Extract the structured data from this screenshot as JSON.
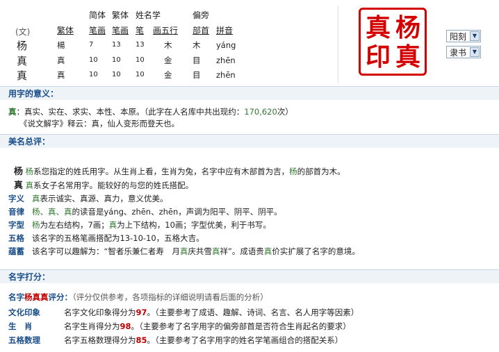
{
  "top_table": {
    "header_row1": {
      "jianti": "简体",
      "fanti": "繁体",
      "xingming": "姓名学",
      "pianpang": "偏旁"
    },
    "header_row2": {
      "wen": "(文)",
      "fanti": "繁体",
      "jianti_bihua": "笔画",
      "fanti_bihua": "笔画",
      "bi": "笔",
      "hua_wuxing": "画五行",
      "bushou": "部首",
      "pinyin": "拼音"
    },
    "rows": [
      {
        "char": "杨",
        "fanti": "楊",
        "jb": "7",
        "fb": "13",
        "xb": "13",
        "wuxing": "木",
        "bushou": "木",
        "pinyin": "yáng"
      },
      {
        "char": "真",
        "fanti": "真",
        "jb": "10",
        "fb": "10",
        "xb": "10",
        "wuxing": "金",
        "bushou": "目",
        "pinyin": "zhēn"
      },
      {
        "char": "真",
        "fanti": "真",
        "jb": "10",
        "fb": "10",
        "xb": "10",
        "wuxing": "金",
        "bushou": "目",
        "pinyin": "zhēn"
      }
    ]
  },
  "seal": {
    "c1": "杨",
    "c2": "真",
    "c3": "真",
    "c4": "印",
    "color": "#d40000"
  },
  "selects": {
    "style1": "阳刻",
    "style2": "隶书"
  },
  "sec_yiyi": {
    "title": "用字的意义：",
    "char": "真",
    "line1": "：真实、实在、求实、本性、本原。（此字在人名库中共出现约：",
    "count": "170,620",
    "line1_end": "次）",
    "line2": "《说文解字》释云：真，仙人变形而登天也。"
  },
  "sec_zongping": {
    "title": "美名总评：",
    "c1": "杨",
    "c1_text_a": "杨",
    "c1_text_b": "系您指定的姓氏用字。从生肖上看，生肖为兔，名字中应有木部首为吉，",
    "c1_text_c": "杨",
    "c1_text_d": "的部首为木。",
    "c2": "真",
    "c2_text_a": "真",
    "c2_text_b": "系女子名常用字。能较好的与您的姓氏搭配。",
    "ziyi_label": "字义",
    "ziyi_a": "真",
    "ziyi_b": "表示诚实、真源、真力，意义优美。",
    "yinlv_label": "音律",
    "yinlv_a": "杨、真、真",
    "yinlv_b": "的读音是yáng、zhēn、zhēn，声调为阳平、阴平、阴平。",
    "zixing_label": "字型",
    "zixing_a": "杨",
    "zixing_b": "为左右结构，7画；",
    "zixing_c": "真",
    "zixing_d": "为上下结构，10画；字型优美，利于书写。",
    "wuge_label": "五格",
    "wuge_text": "该名字的五格笔画搭配为13-10-10，五格大吉。",
    "yunhan_label": "蕴蓄",
    "yunhan_a": "该名字可以趣解为：“智者乐兼仁者寿　月",
    "yunhan_b": "真",
    "yunhan_c": "庆共雪",
    "yunhan_d": "真",
    "yunhan_e": "祥”。成语贵",
    "yunhan_f": "真",
    "yunhan_g": "价实扩展了名字的意境。"
  },
  "sec_dafen": {
    "title": "名字打分：",
    "name_prefix": "名字",
    "name": "杨真真",
    "name_suffix": "评分：",
    "note": "（评分仅供参考，各项指标的详细说明请看后面的分析）",
    "rows": [
      {
        "label": "文化印象",
        "text_a": "名字文化印象得分为",
        "score": "97",
        "text_b": "。（主要参考了成语、趣解、诗词、名言、名人用字等因素）"
      },
      {
        "label": "生　肖",
        "text_a": "名字生肖得分为",
        "score": "98",
        "text_b": "。（主要参考了名字用字的偏旁部首是否符合生肖起名的要求）"
      },
      {
        "label": "五格数理",
        "text_a": "名字五格数理得分为",
        "score": "85",
        "text_b": "。（主要参考了名字用字的姓名学笔画组合的搭配关系）"
      }
    ]
  }
}
